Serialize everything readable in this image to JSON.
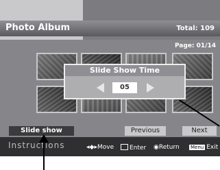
{
  "header": {
    "title": "Photo Album",
    "total": "Total: 109"
  },
  "main": {
    "page": "Page: 01/14"
  },
  "dialog": {
    "title": "Slide Show Time",
    "value": "05"
  },
  "buttons": {
    "slideshow": "Slide show",
    "previous": "Previous",
    "next": "Next"
  },
  "instructions": {
    "label": "Instructions",
    "move": "Move",
    "enter": "Enter",
    "return": "Return",
    "menu_key": "Menu",
    "exit": "Exit"
  }
}
